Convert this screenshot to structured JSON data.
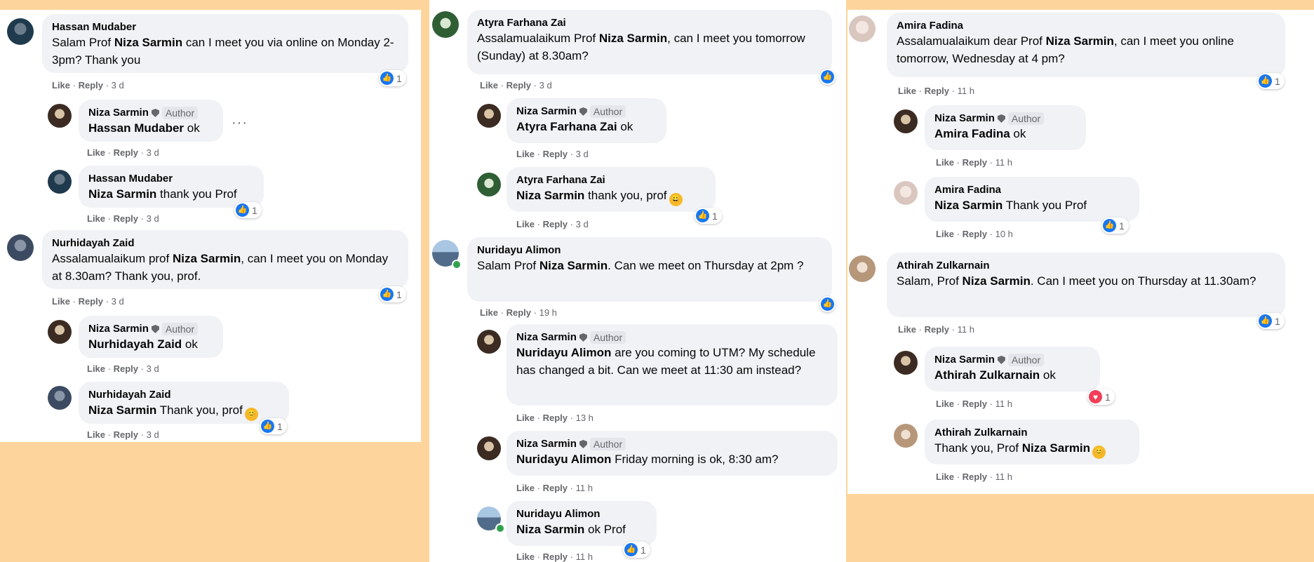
{
  "author_badge": "Author",
  "like_label": "Like",
  "reply_label": "Reply",
  "sep": "·",
  "colors": {
    "background": "#fdd49b",
    "bubble": "#f0f2f5",
    "like": "#1877f2",
    "love": "#f33e58"
  },
  "panels": [
    {
      "comments": [
        {
          "name": "Hassan Mudaber",
          "pre": "Salam Prof ",
          "mention": "Niza Sarmin",
          "post": " can I meet you via online on Monday 2-3pm? Thank you",
          "time": "3 d",
          "reaction": "like",
          "count": "1"
        },
        {
          "name": "Niza Sarmin",
          "author": true,
          "mention": "Hassan Mudaber",
          "post": " ok",
          "time": "3 d",
          "more": "···"
        },
        {
          "name": "Hassan Mudaber",
          "mention": "Niza Sarmin",
          "post": " thank you Prof",
          "time": "3 d",
          "reaction": "like",
          "count": "1"
        },
        {
          "name": "Nurhidayah Zaid",
          "pre": "Assalamualaikum prof ",
          "mention": "Niza Sarmin",
          "post": ", can I meet you on Monday at 8.30am? Thank you, prof.",
          "time": "3 d",
          "reaction": "like",
          "count": "1"
        },
        {
          "name": "Niza Sarmin",
          "author": true,
          "mention": "Nurhidayah Zaid",
          "post": " ok",
          "time": "3 d"
        },
        {
          "name": "Nurhidayah Zaid",
          "mention": "Niza Sarmin",
          "post": " Thank you, prof",
          "emoji": "😊",
          "time": "3 d",
          "reaction": "like",
          "count": "1"
        }
      ]
    },
    {
      "comments": [
        {
          "name": "Atyra Farhana Zai",
          "pre": "Assalamualaikum Prof ",
          "mention": "Niza Sarmin",
          "post": ", can I meet you tomorrow (Sunday) at 8.30am?",
          "time": "3 d",
          "reaction": "like"
        },
        {
          "name": "Niza Sarmin",
          "author": true,
          "mention": "Atyra Farhana Zai",
          "post": " ok",
          "time": "3 d"
        },
        {
          "name": "Atyra Farhana Zai",
          "mention": "Niza Sarmin",
          "post": " thank you, prof",
          "emoji": "😀",
          "time": "3 d",
          "reaction": "like",
          "count": "1"
        },
        {
          "name": "Nuridayu Alimon",
          "pre": "Salam Prof ",
          "mention": "Niza Sarmin",
          "post": ". Can we meet on Thursday at 2pm ?",
          "time": "19 h",
          "reaction": "like"
        },
        {
          "name": "Niza Sarmin",
          "author": true,
          "mention": "Nuridayu Alimon",
          "post": " are you coming to UTM? My schedule has changed a bit. Can we meet at 11:30 am instead?",
          "time": "13 h"
        },
        {
          "name": "Niza Sarmin",
          "author": true,
          "mention": "Nuridayu Alimon",
          "post": " Friday morning is ok, 8:30 am?",
          "time": "11 h"
        },
        {
          "name": "Nuridayu Alimon",
          "mention": "Niza Sarmin",
          "post": " ok Prof",
          "time": "11 h",
          "reaction": "like",
          "count": "1"
        }
      ]
    },
    {
      "comments": [
        {
          "name": "Amira Fadina",
          "pre": "Assalamualaikum dear Prof ",
          "mention": "Niza Sarmin",
          "post": ", can I meet you online tomorrow, Wednesday at 4 pm?",
          "time": "11 h",
          "reaction": "like",
          "count": "1"
        },
        {
          "name": "Niza Sarmin",
          "author": true,
          "mention": "Amira Fadina",
          "post": " ok",
          "time": "11 h"
        },
        {
          "name": "Amira Fadina",
          "mention": "Niza Sarmin",
          "post": " Thank you Prof",
          "time": "10 h",
          "reaction": "like",
          "count": "1"
        },
        {
          "name": "Athirah Zulkarnain",
          "pre": "Salam, Prof ",
          "mention": "Niza Sarmin",
          "post": ". Can I meet you on Thursday at 11.30am?",
          "time": "11 h",
          "reaction": "like",
          "count": "1"
        },
        {
          "name": "Niza Sarmin",
          "author": true,
          "mention": "Athirah Zulkarnain",
          "post": " ok",
          "time": "11 h",
          "reaction": "love",
          "count": "1"
        },
        {
          "name": "Athirah Zulkarnain",
          "pre": "Thank you, Prof ",
          "mention": "Niza Sarmin",
          "emoji": "😊",
          "time": "11 h"
        }
      ]
    }
  ]
}
